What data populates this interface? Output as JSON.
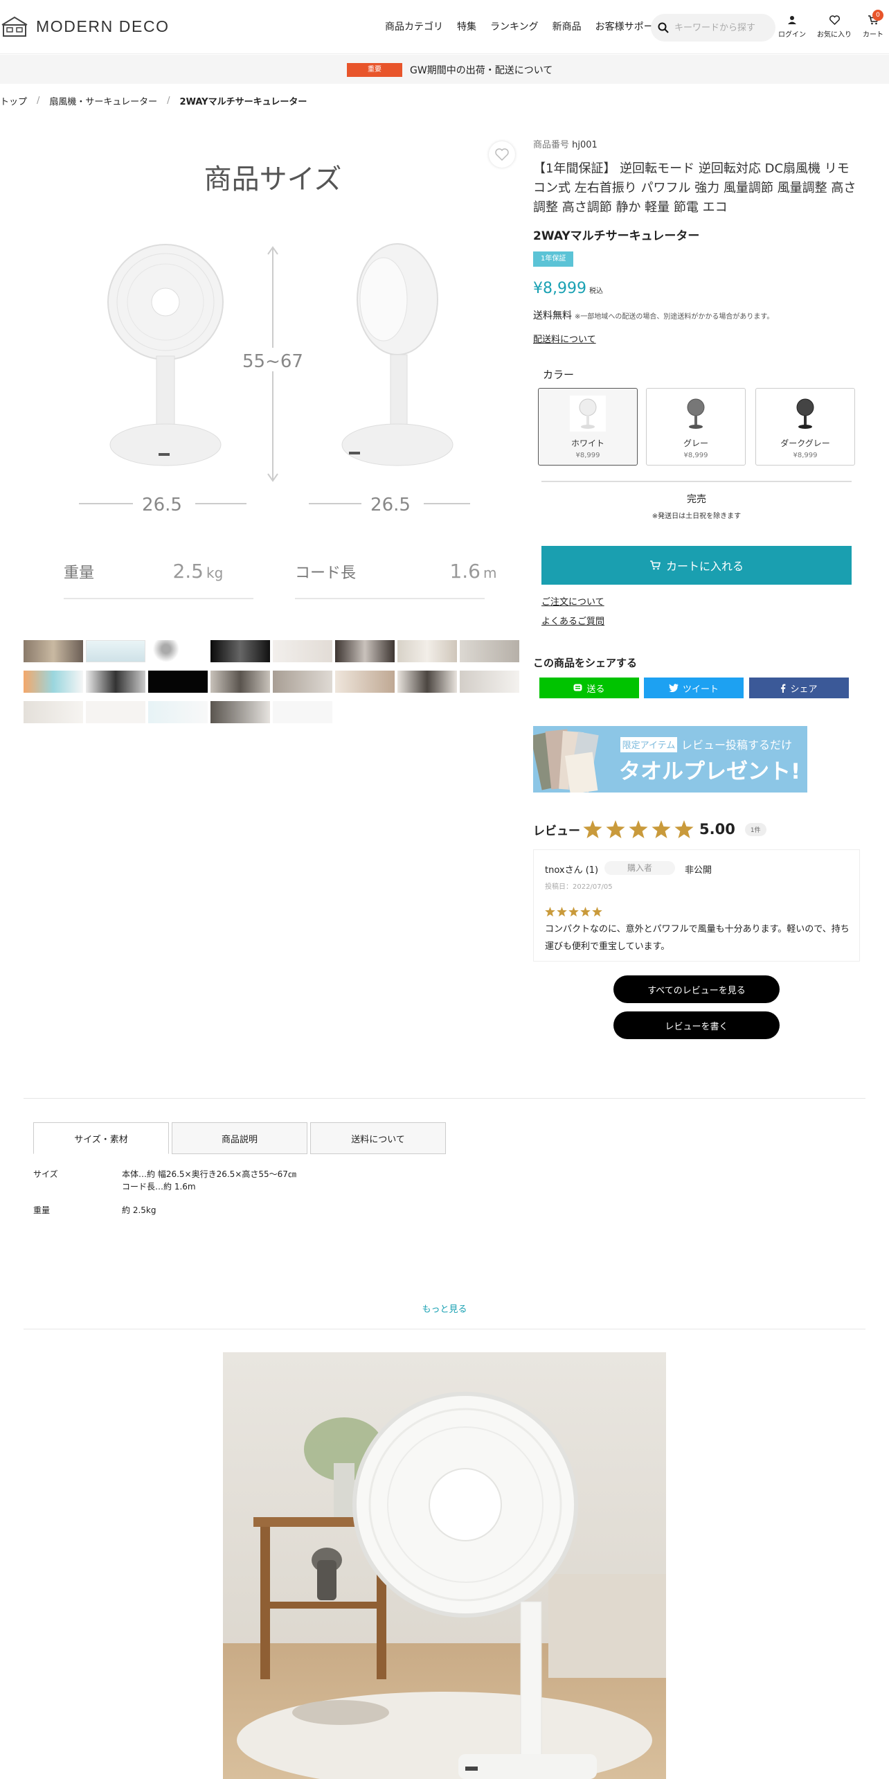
{
  "header": {
    "logo_text": "MODERN DECO",
    "nav": [
      "商品カテゴリ",
      "特集",
      "ランキング",
      "新商品",
      "お客様サポート"
    ],
    "search_placeholder": "キーワードから探す",
    "login_label": "ログイン",
    "favorites_label": "お気に入り",
    "cart_label": "カート",
    "cart_count": "0"
  },
  "notice": {
    "badge": "重要",
    "text": "GW期間中の出荷・配送について"
  },
  "breadcrumb": [
    "トップ",
    "扇風機・サーキュレーター",
    "2WAYマルチサーキュレーター"
  ],
  "main_image": {
    "title": "商品サイズ",
    "height_label": "55~67",
    "width_label_left": "26.5",
    "width_label_right": "26.5",
    "weight_label": "重量",
    "weight_value": "2.5",
    "weight_unit": "kg",
    "cord_label": "コード長",
    "cord_value": "1.6",
    "cord_unit": "m"
  },
  "product": {
    "code_label": "商品番号",
    "code": "hj001",
    "title": "【1年間保証】 逆回転モード 逆回転対応 DC扇風機 リモコン式 左右首振り パワフル 強力 風量調節 風量調整 高さ調整 高さ調節 静か 軽量 節電 エコ",
    "subtitle": "2WAYマルチサーキュレーター",
    "warranty_badge": "1年保証",
    "price": "¥8,999",
    "tax_label": "税込",
    "shipping": "送料無料",
    "shipping_note": "※一部地域への配送の場合、別途送料がかかる場合があります。",
    "shipping_link": "配送料について"
  },
  "color": {
    "label": "カラー",
    "options": [
      {
        "name": "ホワイト",
        "price": "¥8,999"
      },
      {
        "name": "グレー",
        "price": "¥8,999"
      },
      {
        "name": "ダークグレー",
        "price": "¥8,999"
      }
    ]
  },
  "stock": {
    "status": "完売",
    "note": "※発送日は土日祝を除きます"
  },
  "cart_button": "カートに入れる",
  "links": {
    "order": "ご注文について",
    "faq": "よくあるご質問"
  },
  "share": {
    "title": "この商品をシェアする",
    "line": "送る",
    "twitter": "ツイート",
    "facebook": "シェア"
  },
  "banner": {
    "tag": "限定アイテム",
    "line1": "レビュー投稿するだけ",
    "line2": "タオルプレゼント!"
  },
  "reviews": {
    "title": "レビュー",
    "score": "5.00",
    "count": "1件",
    "item": {
      "user": "tnoxさん (1)",
      "tag": "購入者",
      "visibility": "非公開",
      "date": "投稿日：2022/07/05",
      "rating": 5,
      "text": "コンパクトなのに、意外とパワフルで風量も十分あります。軽いので、持ち運びも便利で重宝しています。"
    },
    "all_button": "すべてのレビューを見る",
    "write_button": "レビューを書く"
  },
  "tabs": [
    "サイズ・素材",
    "商品説明",
    "送料について"
  ],
  "specs": [
    {
      "key": "サイズ",
      "lines": [
        "本体…約 幅26.5×奥行き26.5×高さ55～67㎝",
        "コード長…約 1.6m"
      ]
    },
    {
      "key": "重量",
      "lines": [
        "約 2.5kg"
      ]
    }
  ],
  "more_link": "もっと見る",
  "colors": {
    "accent": "#1aa1b3",
    "alert": "#e8552b",
    "star": "#c99a3b",
    "line": "#00c300",
    "twitter": "#1da1f2",
    "facebook": "#3b5998"
  }
}
